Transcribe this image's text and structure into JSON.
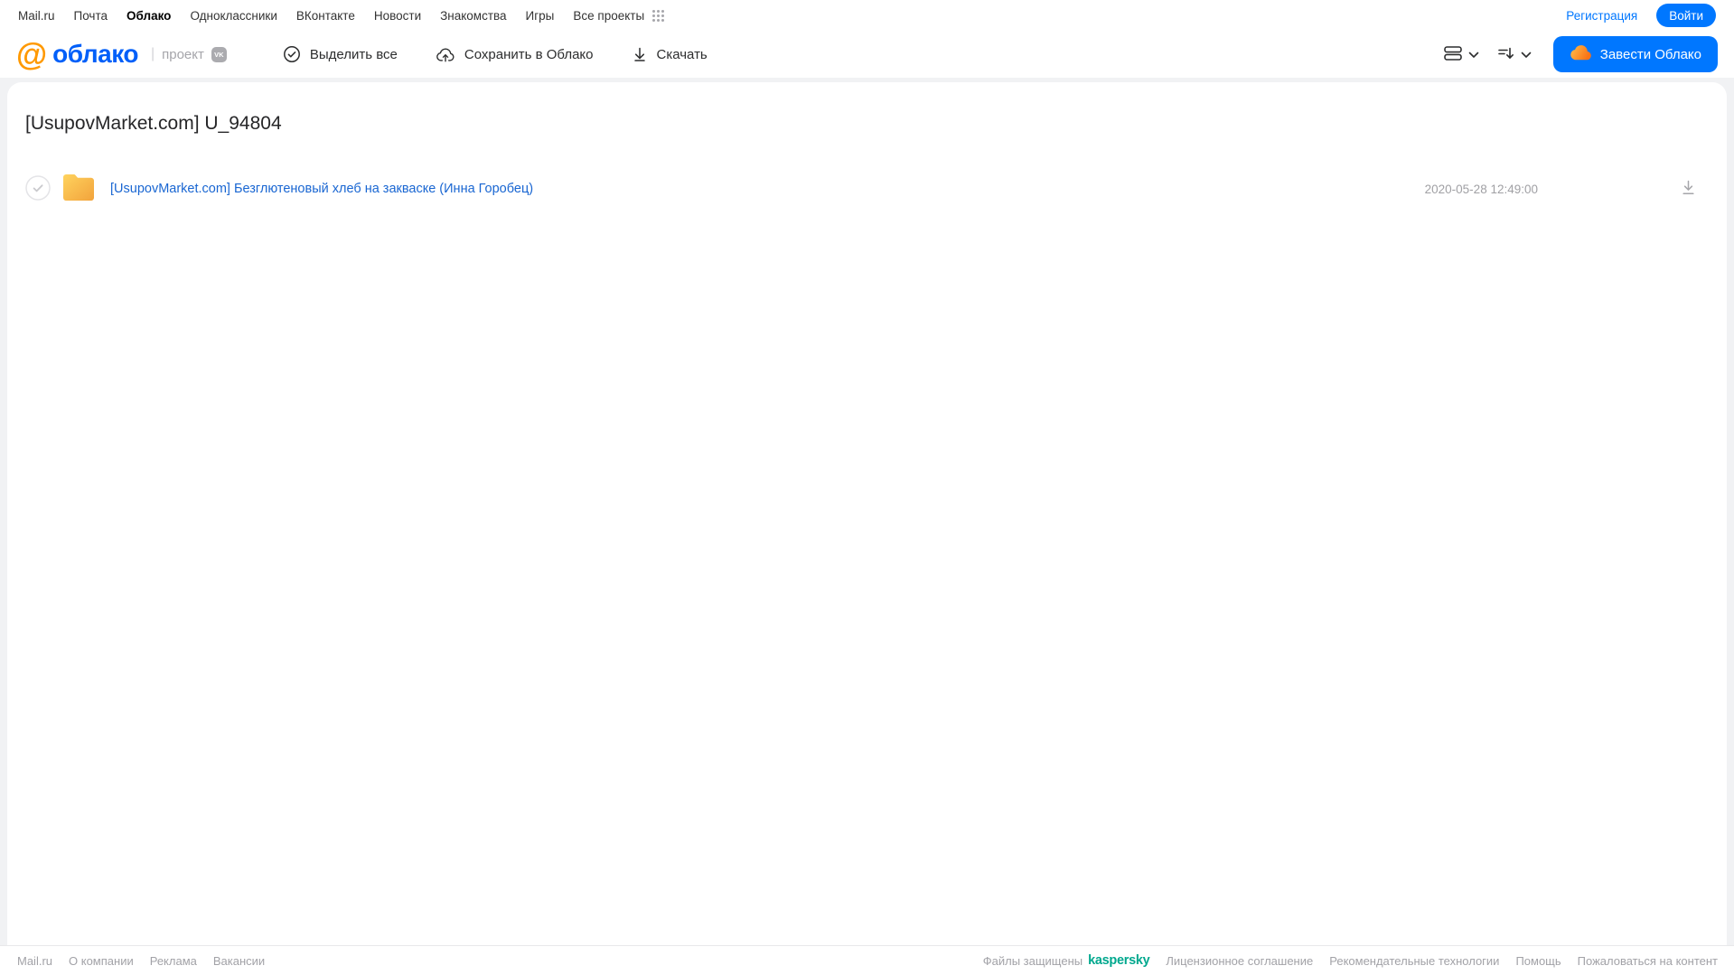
{
  "topbar": {
    "links": [
      "Mail.ru",
      "Почта",
      "Облако",
      "Одноклассники",
      "ВКонтакте",
      "Новости",
      "Знакомства",
      "Игры",
      "Все проекты"
    ],
    "active_link": "Облако",
    "registration_label": "Регистрация",
    "login_label": "Войти"
  },
  "header": {
    "logo_at": "@",
    "logo_text": "облако",
    "project_divider": "|",
    "project_label": "проект",
    "vk_badge": "VK",
    "toolbar": {
      "select_all": "Выделить все",
      "save_to_cloud": "Сохранить в Облако",
      "download": "Скачать"
    },
    "create_cloud_label": "Завести Облако"
  },
  "main": {
    "title": "[UsupovMarket.com] U_94804",
    "files": [
      {
        "type": "folder",
        "name": "[UsupovMarket.com] Безглютеновый хлеб на закваске (Инна Горобец)",
        "date": "2020-05-28 12:49:00"
      }
    ]
  },
  "footer": {
    "links_left": [
      "Mail.ru",
      "О компании",
      "Реклама",
      "Вакансии"
    ],
    "protected_text": "Файлы защищены",
    "kaspersky_label": "kaspersky",
    "links_right": [
      "Лицензионное соглашение",
      "Рекомендательные технологии",
      "Помощь",
      "Пожаловаться на контент"
    ]
  },
  "colors": {
    "accent_blue": "#0077ff",
    "logo_orange": "#ff9900",
    "logo_blue": "#005ff9",
    "file_link_blue": "#1966d2",
    "kaspersky_green": "#00a88e",
    "folder_gradient_start": "#ffd35e",
    "folder_gradient_end": "#f2a33c",
    "muted_gray": "#a0a0a4"
  }
}
